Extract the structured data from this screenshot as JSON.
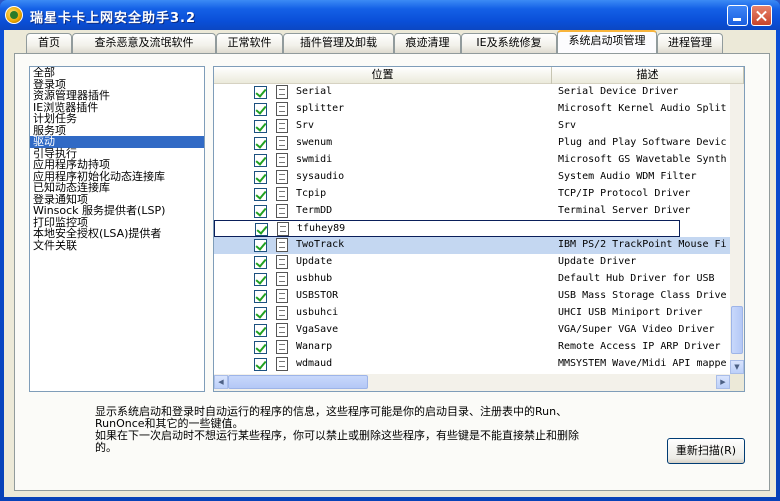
{
  "window": {
    "title": "瑞星卡卡上网安全助手3.2"
  },
  "tabs": [
    {
      "label": "首页"
    },
    {
      "label": "查杀恶意及流氓软件"
    },
    {
      "label": "正常软件"
    },
    {
      "label": "插件管理及卸载"
    },
    {
      "label": "痕迹清理"
    },
    {
      "label": "IE及系统修复"
    },
    {
      "label": "系统启动项管理"
    },
    {
      "label": "进程管理"
    }
  ],
  "sidebar": {
    "items": [
      {
        "label": "全部"
      },
      {
        "label": "登录项"
      },
      {
        "label": "资源管理器插件"
      },
      {
        "label": "IE浏览器插件"
      },
      {
        "label": "计划任务"
      },
      {
        "label": "服务项"
      },
      {
        "label": "驱动"
      },
      {
        "label": "引导执行"
      },
      {
        "label": "应用程序劫持项"
      },
      {
        "label": "应用程序初始化动态连接库"
      },
      {
        "label": "已知动态连接库"
      },
      {
        "label": "登录通知项"
      },
      {
        "label": "Winsock 服务提供者(LSP)"
      },
      {
        "label": "打印监控项"
      },
      {
        "label": "本地安全授权(LSA)提供者"
      },
      {
        "label": "文件关联"
      }
    ]
  },
  "list": {
    "columns": {
      "name": "位置",
      "desc": "描述"
    },
    "rows": [
      {
        "name": "Serial",
        "desc": "Serial Device Driver"
      },
      {
        "name": "splitter",
        "desc": "Microsoft Kernel Audio Split"
      },
      {
        "name": "Srv",
        "desc": "Srv"
      },
      {
        "name": "swenum",
        "desc": "Plug and Play Software Devic"
      },
      {
        "name": "swmidi",
        "desc": "Microsoft GS Wavetable Synth"
      },
      {
        "name": "sysaudio",
        "desc": "System Audio WDM Filter"
      },
      {
        "name": "Tcpip",
        "desc": "TCP/IP Protocol Driver"
      },
      {
        "name": "TermDD",
        "desc": "Terminal Server Driver"
      },
      {
        "name": "tfuhey89",
        "desc": ""
      },
      {
        "name": "TwoTrack",
        "desc": "IBM PS/2 TrackPoint Mouse Fi"
      },
      {
        "name": "Update",
        "desc": "Update Driver"
      },
      {
        "name": "usbhub",
        "desc": "Default Hub Driver for USB"
      },
      {
        "name": "USBSTOR",
        "desc": "USB Mass Storage Class Drive"
      },
      {
        "name": "usbuhci",
        "desc": "UHCI USB Miniport Driver"
      },
      {
        "name": "VgaSave",
        "desc": "VGA/Super VGA Video Driver"
      },
      {
        "name": "Wanarp",
        "desc": "Remote Access IP ARP Driver"
      },
      {
        "name": "wdmaud",
        "desc": "MMSYSTEM Wave/Midi API mappe"
      }
    ]
  },
  "info": {
    "line1": "显示系统启动和登录时自动运行的程序的信息，这些程序可能是你的启动目录、注册表中的Run、",
    "line2": "RunOnce和其它的一些键值。",
    "line3": "如果在下一次启动时不想运行某些程序，你可以禁止或删除这些程序，有些键是不能直接禁止和删除",
    "line4": "的。"
  },
  "rescan_label": "重新扫描(R)"
}
